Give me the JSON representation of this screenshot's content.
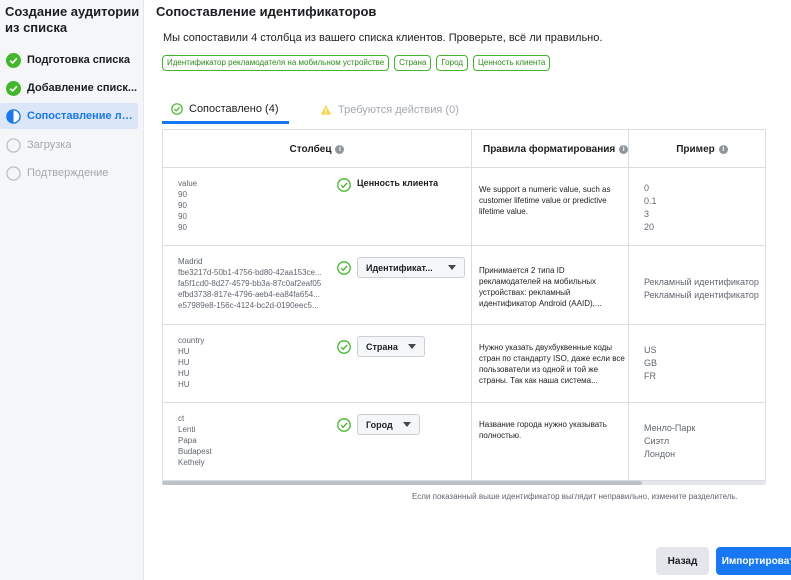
{
  "sidebar": {
    "title": "Создание аудитории из списка",
    "steps": [
      {
        "label": "Подготовка списка",
        "state": "done"
      },
      {
        "label": "Добавление списк...",
        "state": "done"
      },
      {
        "label": "Сопоставление лич...",
        "state": "active"
      },
      {
        "label": "Загрузка",
        "state": "pending"
      },
      {
        "label": "Подтверждение",
        "state": "pending"
      }
    ]
  },
  "main": {
    "title": "Сопоставление идентификаторов",
    "subtitle": "Мы сопоставили 4 столбца из вашего списка клиентов. Проверьте, всё ли правильно.",
    "chips": [
      "Идентификатор рекламодателя на мобильном устройстве",
      "Страна",
      "Город",
      "Ценность клиента"
    ],
    "tabs": {
      "matched": "Сопоставлено (4)",
      "actions": "Требуются действия (0)"
    },
    "table": {
      "headers": {
        "column": "Столбец",
        "rules": "Правила форматирования",
        "example": "Пример"
      },
      "rows": [
        {
          "samples": [
            "value",
            "90",
            "90",
            "90",
            "90"
          ],
          "match": "Ценность клиента",
          "rule": "We support a numeric value, such as customer lifetime value or predictive lifetime value.",
          "examples": [
            "0",
            "0.1",
            "3",
            "20"
          ]
        },
        {
          "samples": [
            "Madrid",
            "fbe3217d-50b1-4756-bd80-42aa153ce...",
            "fa5f1cd0-8d27-4579-bb3a-87c0af2eaf05",
            "efbd3738-817e-4796-aeb4-ea84fa654...",
            "e57989e8-156c-4124-bc2d-0190eec5..."
          ],
          "match": "Идентификат...",
          "rule": "Принимается 2 типа ID рекламодателей на мобильных устройствах: рекламный идентификатор Android (AAID),...",
          "examples": [
            "Рекламный идентификатор",
            "Рекламный идентификатор"
          ]
        },
        {
          "samples": [
            "country",
            "HU",
            "HU",
            "HU",
            "HU"
          ],
          "match": "Страна",
          "rule": "Нужно указать двухбуквенные коды стран по стандарту ISO, даже если все пользователи из одной и той же страны. Так как наша система...",
          "examples": [
            "US",
            "GB",
            "FR"
          ]
        },
        {
          "samples": [
            "ct",
            "Lenti",
            "Papa",
            "Budapest",
            "Kethely"
          ],
          "match": "Город",
          "rule": "Название города нужно указывать полностью.",
          "examples": [
            "Менло-Парк",
            "Сиэтл",
            "Лондон"
          ]
        }
      ]
    },
    "hint": "Если показанный выше идентификатор выглядит неправильно,",
    "hint_link": "измените разделитель.",
    "buttons": {
      "back": "Назад",
      "import": "Импортировать"
    }
  },
  "colors": {
    "accent": "#1877f2",
    "success": "#42b72a",
    "muted": "#a3a8b0"
  }
}
